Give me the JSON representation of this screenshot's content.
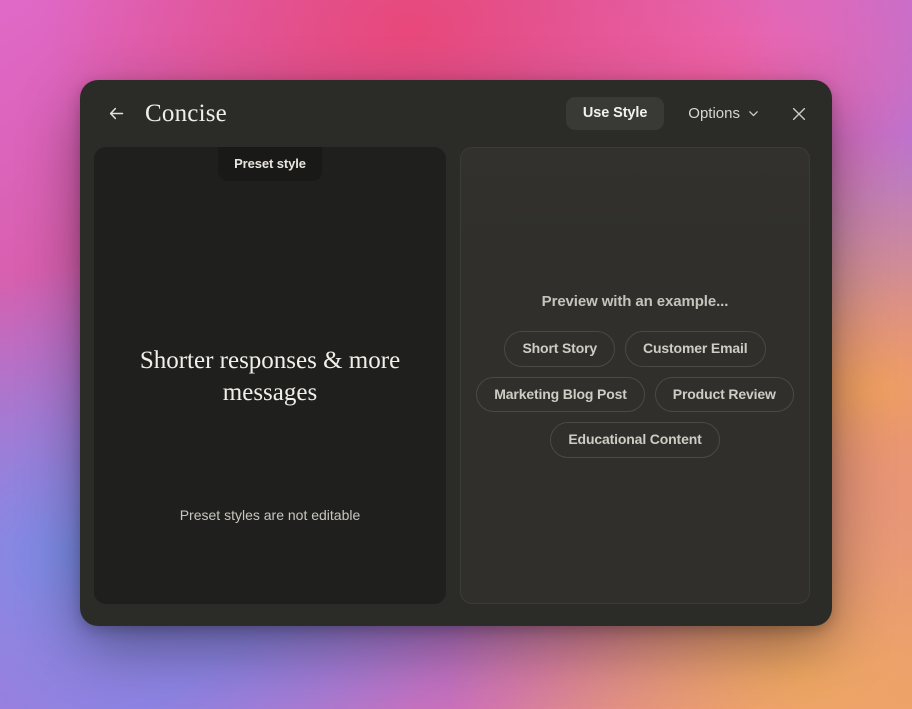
{
  "theme": {
    "modal_bg": "#2b2b28",
    "left_panel_bg": "#1f1f1d",
    "right_panel_bg": "#302f2c",
    "accent_text": "#f2f1ec",
    "muted_text": "#c6c3bb",
    "chip_border": "#4a4944"
  },
  "header": {
    "back_icon": "arrow-left-icon",
    "title": "Concise",
    "use_style_label": "Use Style",
    "options_label": "Options",
    "options_chevron_icon": "chevron-down-icon",
    "close_icon": "close-icon"
  },
  "style_panel": {
    "badge": "Preset style",
    "headline": "Shorter responses & more messages",
    "note": "Preset styles are not editable"
  },
  "preview_panel": {
    "heading": "Preview with an example...",
    "chip_rows": [
      [
        "Short Story",
        "Customer Email"
      ],
      [
        "Marketing Blog Post",
        "Product Review"
      ],
      [
        "Educational Content"
      ]
    ],
    "chips": {
      "r0c0": "Short Story",
      "r0c1": "Customer Email",
      "r1c0": "Marketing Blog Post",
      "r1c1": "Product Review",
      "r2c0": "Educational Content"
    }
  }
}
